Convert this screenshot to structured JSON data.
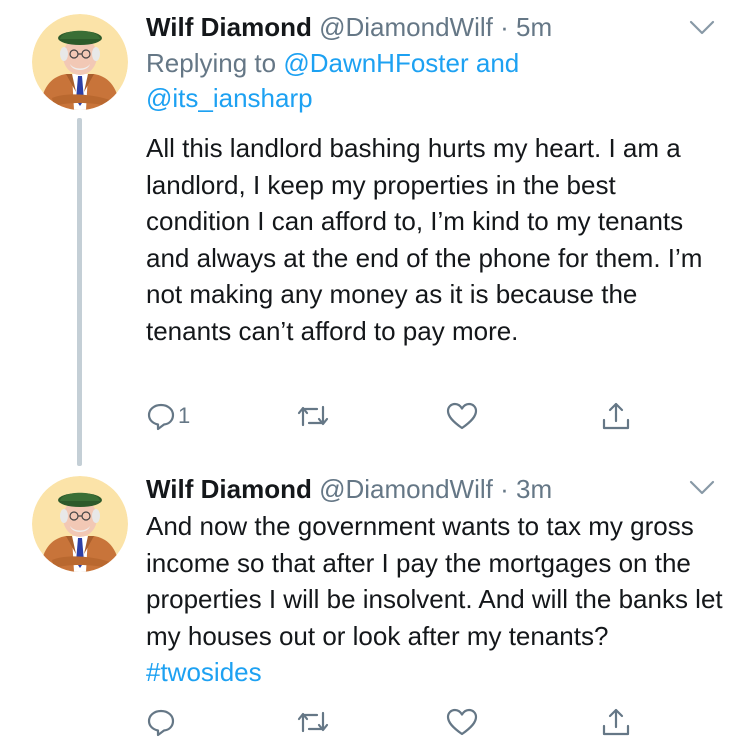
{
  "tweets": [
    {
      "author_name": "Wilf Diamond",
      "author_handle": "@DiamondWilf",
      "separator": "·",
      "timestamp": "5m",
      "reply_prefix": "Replying to",
      "reply_to_1": "@DawnHFoster",
      "reply_and": "and",
      "reply_to_2": "@its_iansharp",
      "text": "All this landlord bashing hurts my heart. I am a landlord, I keep my properties in the best condition I can afford to, I’m kind to my tenants and always at the end of the phone for them. I’m not making any money as it is because the tenants can’t afford to pay more.",
      "reply_count": "1",
      "avatar_icon": "cartoon-man-avatar",
      "menu_icon": "chevron-down-icon"
    },
    {
      "author_name": "Wilf Diamond",
      "author_handle": "@DiamondWilf",
      "separator": "·",
      "timestamp": "3m",
      "text": "And now the government wants to tax my gross income so that after I pay the mortgages on the properties I will be insolvent. And will the banks let my houses out or look after my tenants?",
      "hashtag": "#twosides",
      "avatar_icon": "cartoon-man-avatar",
      "menu_icon": "chevron-down-icon"
    }
  ],
  "colors": {
    "link": "#1da1f2",
    "muted": "#657786",
    "text": "#14171a",
    "thread_line": "#c4cfd6"
  }
}
